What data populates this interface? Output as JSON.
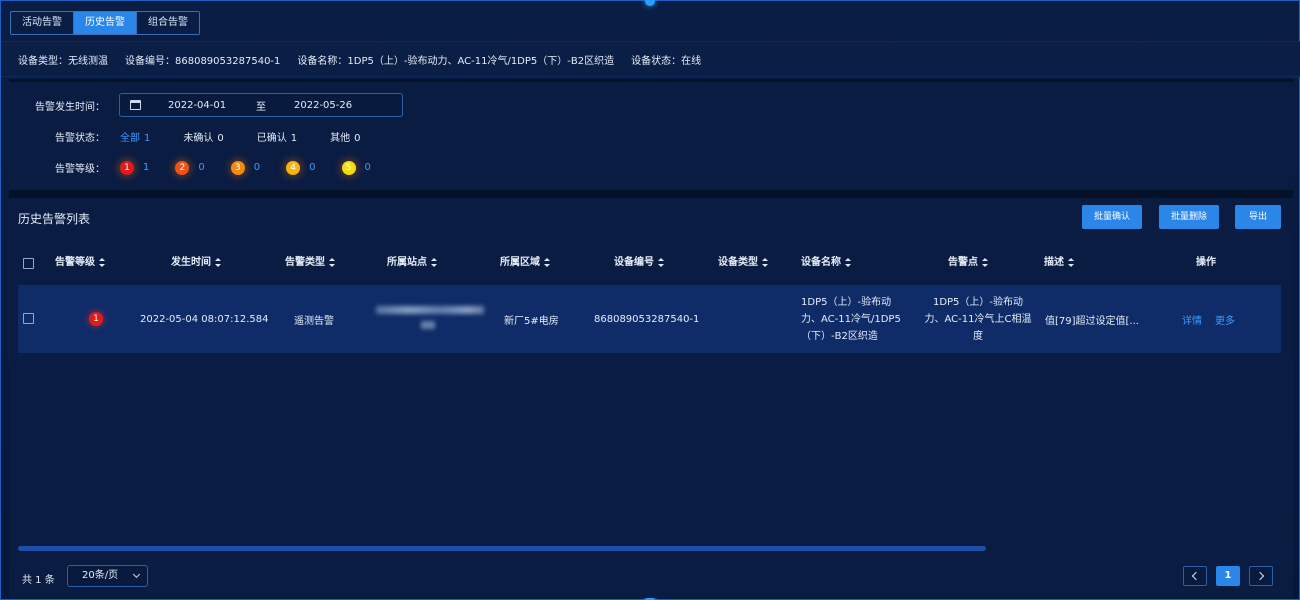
{
  "tabs": [
    "活动告警",
    "历史告警",
    "组合告警"
  ],
  "device_info": {
    "type": "设备类型：无线测温",
    "code": "设备编号：868089053287540-1",
    "name": "设备名称：1DP5（上）-验布动力、AC-11冷气/1DP5（下）-B2区织造",
    "status": "设备状态：在线"
  },
  "filters": {
    "time_label": "告警发生时间：",
    "start_date": "2022-04-01",
    "to": "至",
    "end_date": "2022-05-26",
    "status_label": "告警状态：",
    "status_options": [
      {
        "label": "全部",
        "count": "1"
      },
      {
        "label": "未确认",
        "count": "0"
      },
      {
        "label": "已确认",
        "count": "1"
      },
      {
        "label": "其他",
        "count": "0"
      }
    ],
    "level_label": "告警等级：",
    "levels": [
      {
        "badge": "1",
        "count": "1",
        "color": "#e01b1b"
      },
      {
        "badge": "2",
        "count": "0",
        "color": "#f0521a"
      },
      {
        "badge": "3",
        "count": "0",
        "color": "#f48a12"
      },
      {
        "badge": "4",
        "count": "0",
        "color": "#f5b412"
      },
      {
        "badge": "5",
        "count": "0",
        "color": "#f0dc10"
      }
    ]
  },
  "list": {
    "title": "历史告警列表",
    "buttons": {
      "batch_confirm": "批量确认",
      "batch_delete": "批量删除",
      "export": "导出"
    },
    "columns": [
      "告警等级",
      "发生时间",
      "告警类型",
      "所属站点",
      "所属区域",
      "设备编号",
      "设备类型",
      "设备名称",
      "告警点",
      "描述",
      "操作"
    ],
    "rows": [
      {
        "level": "1",
        "time": "2022-05-04 08:07:12.584",
        "type": "遥测告警",
        "station": "",
        "area": "新厂5#电房",
        "code": "868089053287540-1",
        "device_type": "",
        "name": "1DP5（上）-验布动力、AC-11冷气/1DP5（下）-B2区织造",
        "point": "1DP5（上）-验布动力、AC-11冷气上C相温度",
        "desc": "值[79]超过设定值[...",
        "actions": {
          "detail": "详情",
          "more": "更多"
        }
      }
    ]
  },
  "footer": {
    "total": "共 1 条",
    "page_size": "20条/页",
    "current_page": "1"
  }
}
